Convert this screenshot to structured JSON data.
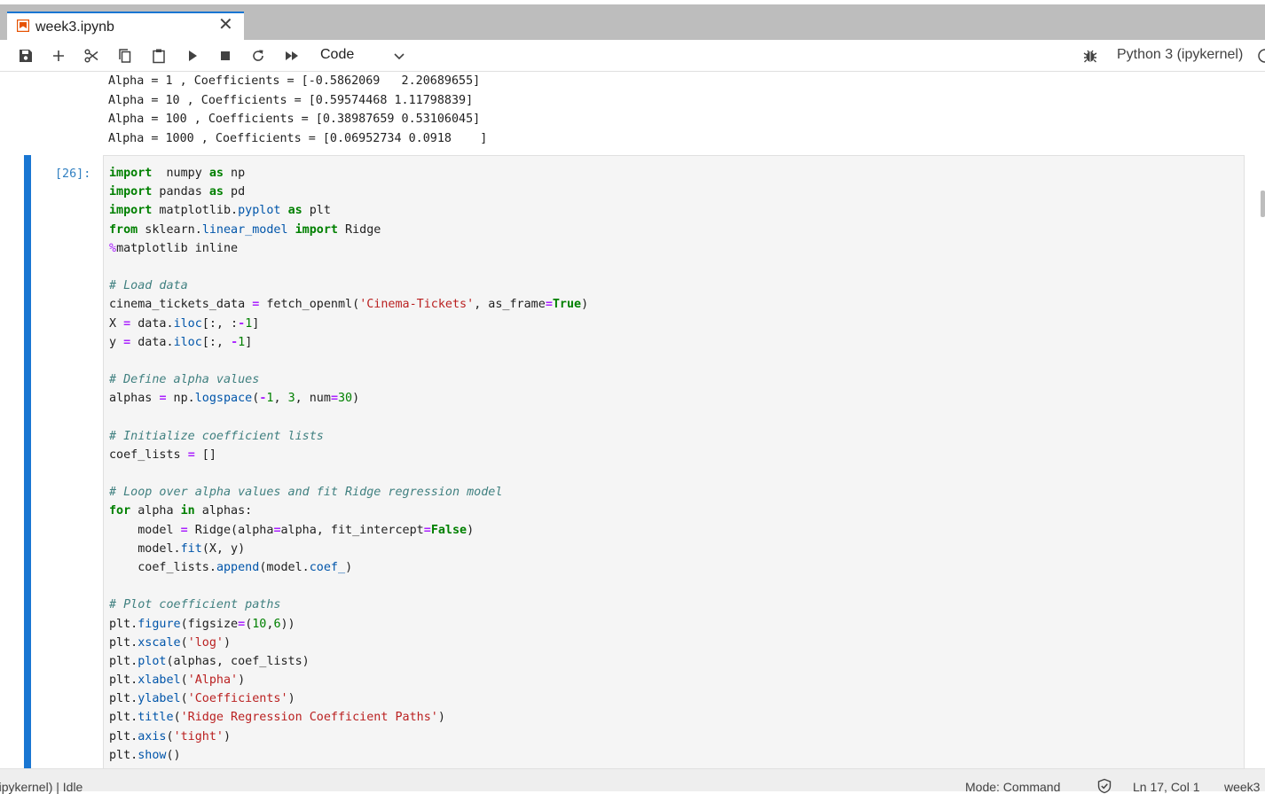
{
  "tab": {
    "title": "week3.ipynb",
    "close": "✕"
  },
  "toolbar": {
    "cell_type": "Code",
    "kernel_name": "Python 3 (ipykernel)",
    "icons": [
      "save-icon",
      "add-icon",
      "cut-icon",
      "copy-icon",
      "paste-icon",
      "run-icon",
      "stop-icon",
      "restart-icon",
      "fast-forward-icon"
    ]
  },
  "output": {
    "lines": [
      "Alpha = 1 , Coefficients = [-0.5862069   2.20689655]",
      "Alpha = 10 , Coefficients = [0.59574468 1.11798839]",
      "Alpha = 100 , Coefficients = [0.38987659 0.53106045]",
      "Alpha = 1000 , Coefficients = [0.06952734 0.0918    ]"
    ]
  },
  "cell": {
    "prompt": "[26]:",
    "code_lines": [
      [
        [
          "kw",
          "import"
        ],
        [
          "",
          "  numpy "
        ],
        [
          "kw",
          "as"
        ],
        [
          "",
          " np"
        ]
      ],
      [
        [
          "kw",
          "import"
        ],
        [
          "",
          " pandas "
        ],
        [
          "kw",
          "as"
        ],
        [
          "",
          " pd"
        ]
      ],
      [
        [
          "kw",
          "import"
        ],
        [
          "",
          " matplotlib."
        ],
        [
          "attr",
          "pyplot"
        ],
        [
          "",
          " "
        ],
        [
          "kw",
          "as"
        ],
        [
          "",
          " plt"
        ]
      ],
      [
        [
          "kw",
          "from"
        ],
        [
          "",
          " sklearn."
        ],
        [
          "attr",
          "linear_model"
        ],
        [
          "",
          " "
        ],
        [
          "kw",
          "import"
        ],
        [
          "",
          " Ridge"
        ]
      ],
      [
        [
          "mag",
          "%"
        ],
        [
          "",
          "matplotlib inline"
        ]
      ],
      [],
      [
        [
          "cm",
          "# Load data"
        ]
      ],
      [
        [
          "",
          "cinema_tickets_data "
        ],
        [
          "op",
          "="
        ],
        [
          "",
          " fetch_openml("
        ],
        [
          "str",
          "'Cinema-Tickets'"
        ],
        [
          "",
          ", as_frame"
        ],
        [
          "op",
          "="
        ],
        [
          "kw",
          "True"
        ],
        [
          "",
          ")"
        ]
      ],
      [
        [
          "",
          "X "
        ],
        [
          "op",
          "="
        ],
        [
          "",
          " data."
        ],
        [
          "attr",
          "iloc"
        ],
        [
          "",
          "[:, :"
        ],
        [
          "op",
          "-"
        ],
        [
          "num",
          "1"
        ],
        [
          "",
          "]"
        ]
      ],
      [
        [
          "",
          "y "
        ],
        [
          "op",
          "="
        ],
        [
          "",
          " data."
        ],
        [
          "attr",
          "iloc"
        ],
        [
          "",
          "[:, "
        ],
        [
          "op",
          "-"
        ],
        [
          "num",
          "1"
        ],
        [
          "",
          "]"
        ]
      ],
      [],
      [
        [
          "cm",
          "# Define alpha values"
        ]
      ],
      [
        [
          "",
          "alphas "
        ],
        [
          "op",
          "="
        ],
        [
          "",
          " np."
        ],
        [
          "attr",
          "logspace"
        ],
        [
          "",
          "("
        ],
        [
          "op",
          "-"
        ],
        [
          "num",
          "1"
        ],
        [
          "",
          ", "
        ],
        [
          "num",
          "3"
        ],
        [
          "",
          ", num"
        ],
        [
          "op",
          "="
        ],
        [
          "num",
          "30"
        ],
        [
          "",
          ")"
        ]
      ],
      [],
      [
        [
          "cm",
          "# Initialize coefficient lists"
        ]
      ],
      [
        [
          "",
          "coef_lists "
        ],
        [
          "op",
          "="
        ],
        [
          "",
          " []"
        ]
      ],
      [],
      [
        [
          "cm",
          "# Loop over alpha values and fit Ridge regression model"
        ]
      ],
      [
        [
          "kw",
          "for"
        ],
        [
          "",
          " alpha "
        ],
        [
          "kw",
          "in"
        ],
        [
          "",
          " alphas:"
        ]
      ],
      [
        [
          "",
          "    model "
        ],
        [
          "op",
          "="
        ],
        [
          "",
          " Ridge(alpha"
        ],
        [
          "op",
          "="
        ],
        [
          "",
          "alpha, fit_intercept"
        ],
        [
          "op",
          "="
        ],
        [
          "kw",
          "False"
        ],
        [
          "",
          ")"
        ]
      ],
      [
        [
          "",
          "    model."
        ],
        [
          "attr",
          "fit"
        ],
        [
          "",
          "(X, y)"
        ]
      ],
      [
        [
          "",
          "    coef_lists."
        ],
        [
          "attr",
          "append"
        ],
        [
          "",
          "(model."
        ],
        [
          "attr",
          "coef_"
        ],
        [
          "",
          ")"
        ]
      ],
      [],
      [
        [
          "cm",
          "# Plot coefficient paths"
        ]
      ],
      [
        [
          "",
          "plt."
        ],
        [
          "attr",
          "figure"
        ],
        [
          "",
          "(figsize"
        ],
        [
          "op",
          "="
        ],
        [
          "",
          "("
        ],
        [
          "num",
          "10"
        ],
        [
          "",
          ","
        ],
        [
          "num",
          "6"
        ],
        [
          "",
          "))"
        ]
      ],
      [
        [
          "",
          "plt."
        ],
        [
          "attr",
          "xscale"
        ],
        [
          "",
          "("
        ],
        [
          "str",
          "'log'"
        ],
        [
          "",
          ")"
        ]
      ],
      [
        [
          "",
          "plt."
        ],
        [
          "attr",
          "plot"
        ],
        [
          "",
          "(alphas, coef_lists)"
        ]
      ],
      [
        [
          "",
          "plt."
        ],
        [
          "attr",
          "xlabel"
        ],
        [
          "",
          "("
        ],
        [
          "str",
          "'Alpha'"
        ],
        [
          "",
          ")"
        ]
      ],
      [
        [
          "",
          "plt."
        ],
        [
          "attr",
          "ylabel"
        ],
        [
          "",
          "("
        ],
        [
          "str",
          "'Coefficients'"
        ],
        [
          "",
          ")"
        ]
      ],
      [
        [
          "",
          "plt."
        ],
        [
          "attr",
          "title"
        ],
        [
          "",
          "("
        ],
        [
          "str",
          "'Ridge Regression Coefficient Paths'"
        ],
        [
          "",
          ")"
        ]
      ],
      [
        [
          "",
          "plt."
        ],
        [
          "attr",
          "axis"
        ],
        [
          "",
          "("
        ],
        [
          "str",
          "'tight'"
        ],
        [
          "",
          ")"
        ]
      ],
      [
        [
          "",
          "plt."
        ],
        [
          "attr",
          "show"
        ],
        [
          "",
          "()"
        ]
      ]
    ]
  },
  "status": {
    "left": "(ipykernel) | Idle",
    "mode": "Mode: Command",
    "position": "Ln 17, Col 1",
    "file": "week3"
  }
}
